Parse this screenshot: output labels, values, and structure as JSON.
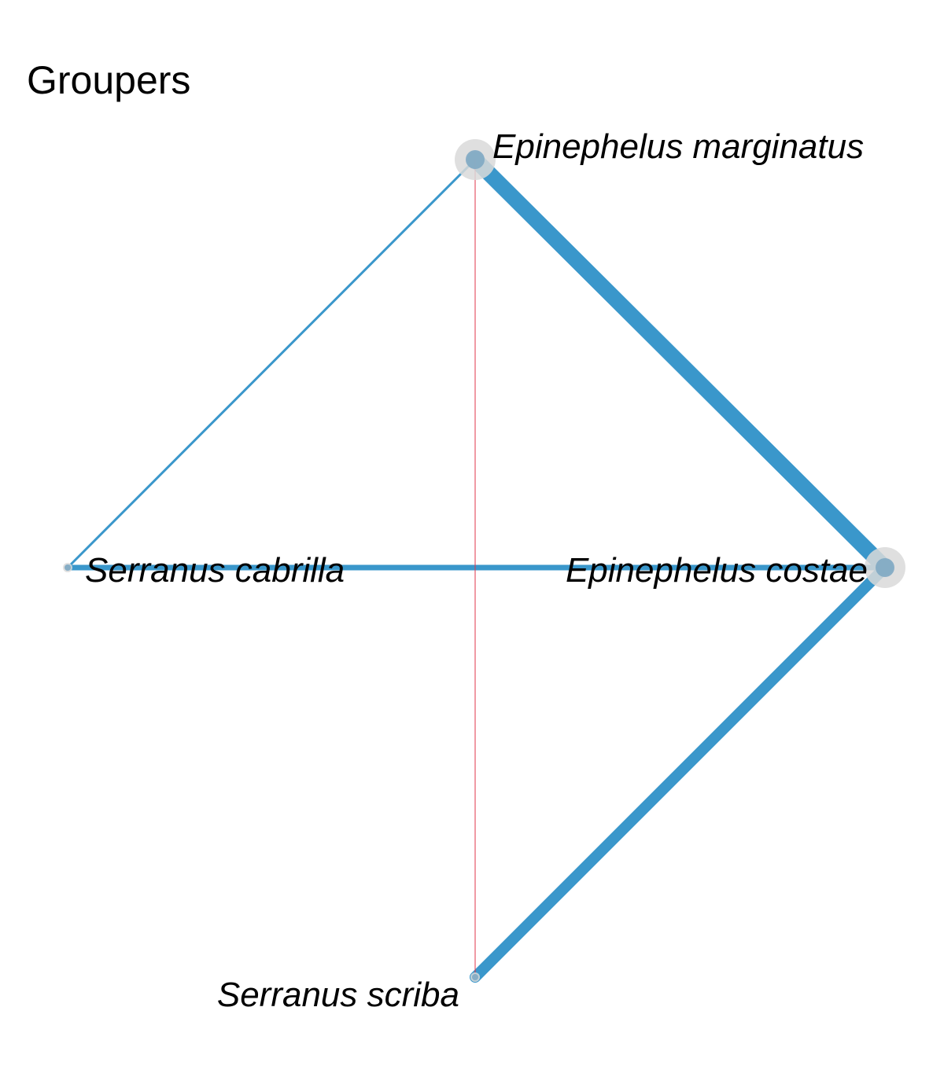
{
  "title": "Groupers",
  "colors": {
    "edge": "#3a97cb",
    "highlight_edge": "#e0364a",
    "node_halo": "#d9d9d9",
    "node_core": "#7fa8c3",
    "label": "#000000",
    "background": "#ffffff"
  },
  "nodes": [
    {
      "id": "em",
      "label": "Epinephelus marginatus",
      "size": "large"
    },
    {
      "id": "ec",
      "label": "Epinephelus costae",
      "size": "large"
    },
    {
      "id": "sc",
      "label": "Serranus cabrilla",
      "size": "small"
    },
    {
      "id": "ss",
      "label": "Serranus scriba",
      "size": "small"
    }
  ],
  "edges": [
    {
      "source": "em",
      "target": "ec",
      "weight": "heavy",
      "color": "edge"
    },
    {
      "source": "em",
      "target": "sc",
      "weight": "thin",
      "color": "edge"
    },
    {
      "source": "sc",
      "target": "ec",
      "weight": "medium",
      "color": "edge"
    },
    {
      "source": "ec",
      "target": "ss",
      "weight": "heavy-medium",
      "color": "edge"
    },
    {
      "source": "em",
      "target": "ss",
      "weight": "hairline",
      "color": "highlight_edge"
    }
  ]
}
